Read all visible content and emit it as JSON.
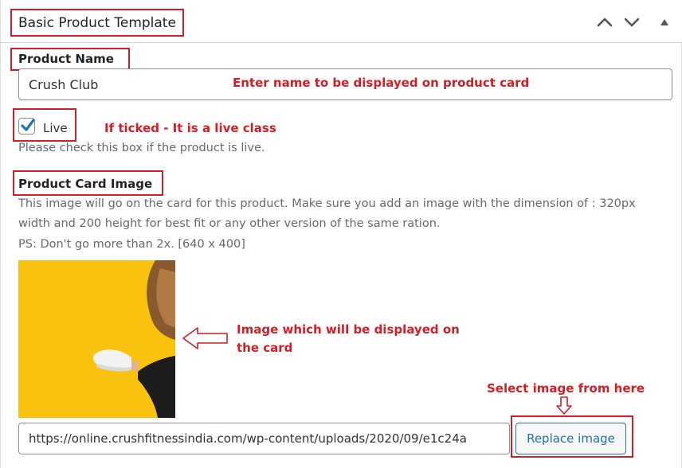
{
  "panel": {
    "title": "Basic Product Template",
    "controls": [
      "chevron-up-icon",
      "chevron-down-icon",
      "triangle-up-icon"
    ]
  },
  "product_name": {
    "label": "Product Name",
    "value": "Crush Club"
  },
  "live": {
    "checked": true,
    "label": "Live",
    "help": "Please check this box if the product is live."
  },
  "card_image": {
    "label": "Product Card Image",
    "help_line1": "This image will go on the card for this product. Make sure you add an image with the dimension of : 320px",
    "help_line2": "width and 200 height for best fit or any other version of the same ration.",
    "help_line3": "PS: Don't go more than 2x. [640 x 400]",
    "url": "https://online.crushfitnessindia.com/wp-content/uploads/2020/09/e1c24a",
    "button_label": "Replace image"
  },
  "annotations": {
    "name_note": "Enter name to be displayed on product card",
    "live_note": "If ticked - It is a live class",
    "image_note_line1": "Image which will be displayed on",
    "image_note_line2": "the card",
    "select_note": "Select image from here"
  },
  "colors": {
    "annotation_red": "#d01f26",
    "accent_blue": "#2271b1",
    "image_yellow": "#f9c20f"
  }
}
